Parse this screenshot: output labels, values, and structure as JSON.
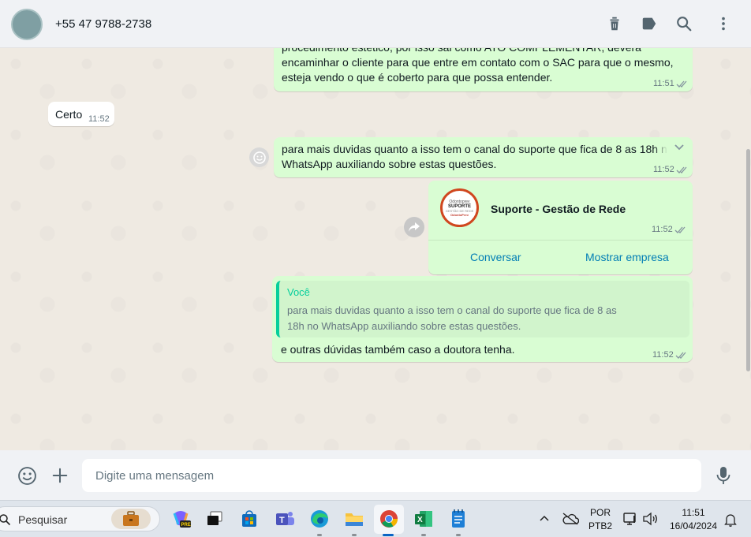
{
  "header": {
    "contact_name": "+55 47 9788-2738",
    "icons": [
      "delete-icon",
      "label-icon",
      "search-icon",
      "more-options-icon"
    ]
  },
  "messages": [
    {
      "id": "m1",
      "direction": "outgoing",
      "lines": [
        "procedimento estético, por isso sai como ATO COMPLEMENTAR, deverá",
        "encaminhar o cliente para que entre em contato com o SAC para que o mesmo,",
        "esteja vendo o que é coberto para que possa entender."
      ],
      "time": "11:51",
      "status": "read"
    },
    {
      "id": "m2",
      "direction": "incoming",
      "text": "Certo",
      "time": "11:52"
    },
    {
      "id": "m3",
      "direction": "outgoing",
      "lines": [
        "para mais duvidas quanto a isso tem o canal do suporte que fica de 8 as 18h no",
        "WhatsApp auxiliando sobre estas questões."
      ],
      "time": "11:52",
      "status": "read"
    },
    {
      "id": "m4",
      "direction": "outgoing",
      "type": "contact_card",
      "logo_lines": [
        "Odontoprev",
        "SUPORTE",
        "GESTÃO DE REDE",
        "OdontoPrev"
      ],
      "contact_name": "Suporte - Gestão de Rede",
      "time": "11:52",
      "status": "read",
      "buttons": [
        "Conversar",
        "Mostrar empresa"
      ]
    },
    {
      "id": "m5",
      "direction": "outgoing",
      "type": "reply",
      "quote_author": "Você",
      "quote_lines": [
        "para mais duvidas quanto a isso tem o canal do suporte que fica de 8 as",
        "18h no WhatsApp auxiliando sobre estas questões."
      ],
      "text": "e outras dúvidas também caso a doutora tenha.",
      "time": "11:52",
      "status": "read"
    }
  ],
  "composer": {
    "placeholder": "Digite uma mensagem",
    "icons": [
      "emoji-icon",
      "attach-plus-icon",
      "microphone-icon"
    ]
  },
  "taskbar": {
    "search_label": "Pesquisar",
    "apps": [
      "work-briefcase",
      "copilot-pre",
      "task-view",
      "microsoft-store",
      "teams",
      "edge",
      "file-explorer",
      "chrome",
      "excel",
      "notepad"
    ],
    "active_app": "chrome",
    "language": "POR",
    "layout": "PTB2",
    "clock_time": "11:51",
    "clock_date": "16/04/2024"
  },
  "colors": {
    "outgoing_bubble": "#d9fdd3",
    "incoming_bubble": "#ffffff",
    "chat_background": "#efeae2",
    "read_ticks": "#53bdeb",
    "link_blue": "#027eb5",
    "quote_accent": "#06cf9c"
  }
}
